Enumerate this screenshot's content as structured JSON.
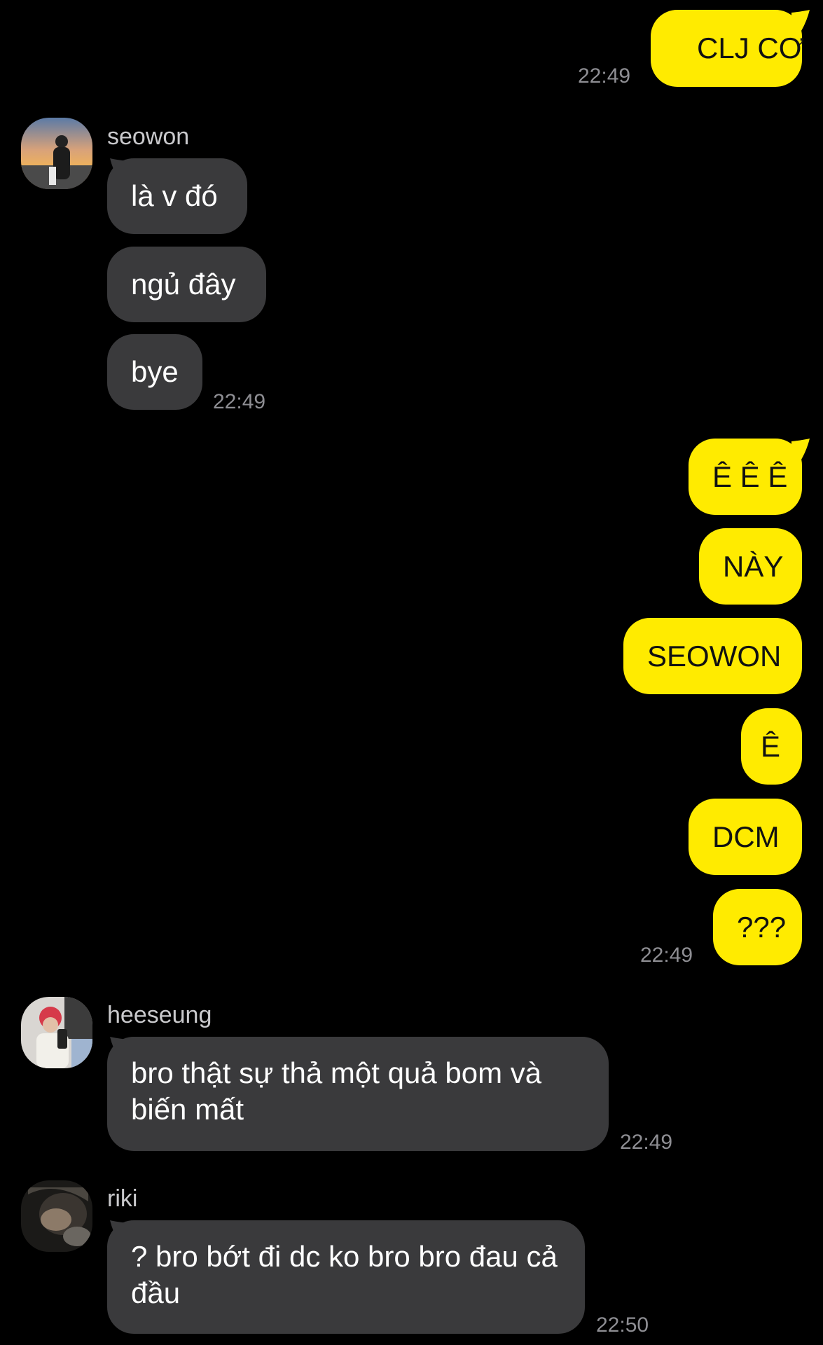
{
  "conversation": [
    {
      "type": "me",
      "text": "CLJ CƠ",
      "time": "22:49"
    },
    {
      "type": "them",
      "sender": "seowon",
      "messages": [
        "là v đó",
        "ngủ đây",
        "bye"
      ],
      "time": "22:49"
    },
    {
      "type": "me",
      "messages": [
        "Ê Ê Ê",
        "NÀY",
        "SEOWON",
        "Ê",
        "DCM",
        "???"
      ],
      "time": "22:49"
    },
    {
      "type": "them",
      "sender": "heeseung",
      "text": "bro thật sự thả một quả bom và biến mất",
      "time": "22:49"
    },
    {
      "type": "them",
      "sender": "riki",
      "text": "? bro bớt đi dc ko bro bro đau cả đầu",
      "time": "22:50"
    }
  ],
  "colors": {
    "background": "#000000",
    "my_bubble": "#ffeb00",
    "their_bubble": "#3a3a3c",
    "timestamp": "#8e8e93"
  }
}
